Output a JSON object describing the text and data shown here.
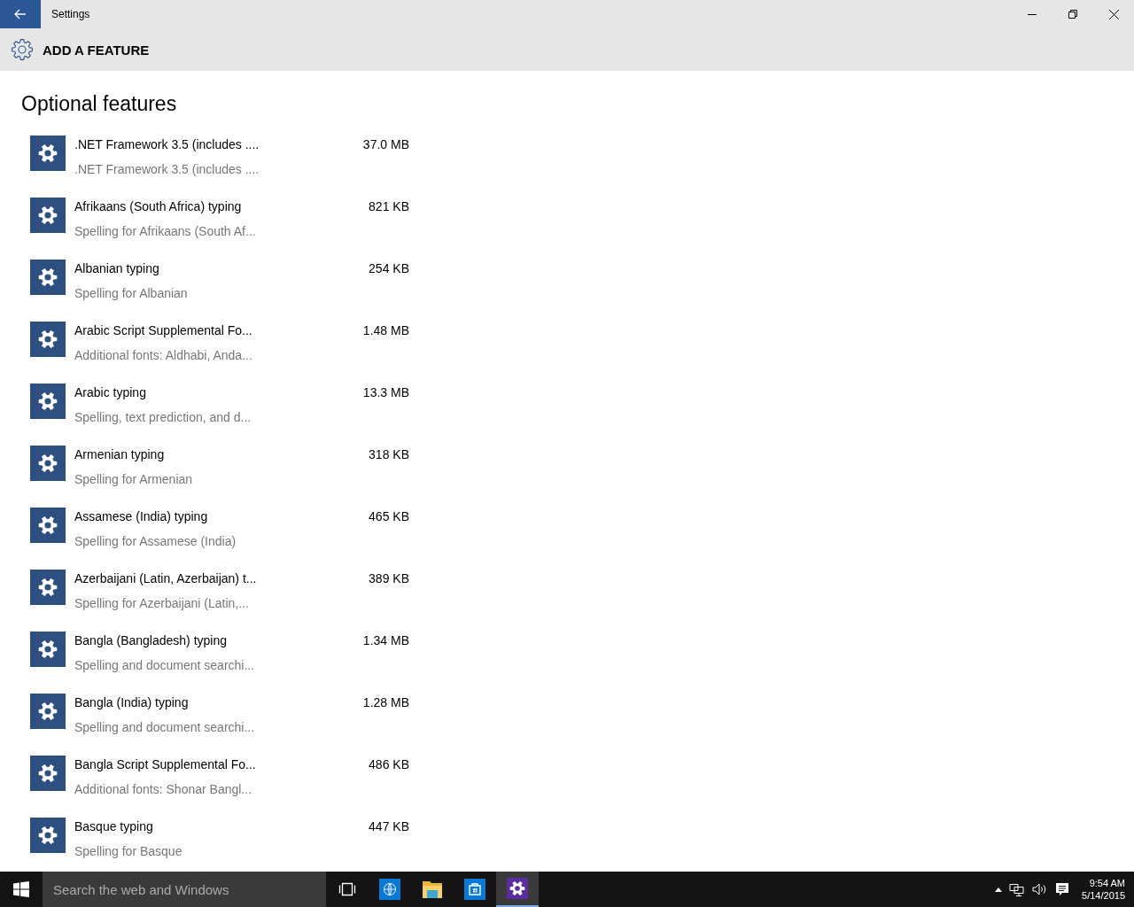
{
  "window": {
    "title": "Settings"
  },
  "header": {
    "title": "ADD A FEATURE"
  },
  "section": {
    "heading": "Optional features"
  },
  "features": [
    {
      "name": ".NET Framework 3.5 (includes ....",
      "size": "37.0 MB",
      "description": ".NET Framework 3.5 (includes ...."
    },
    {
      "name": "Afrikaans (South Africa) typing",
      "size": "821 KB",
      "description": "Spelling for Afrikaans (South Af..."
    },
    {
      "name": "Albanian typing",
      "size": "254 KB",
      "description": "Spelling for Albanian"
    },
    {
      "name": "Arabic Script Supplemental Fo...",
      "size": "1.48 MB",
      "description": "Additional fonts: Aldhabi, Anda..."
    },
    {
      "name": "Arabic typing",
      "size": "13.3 MB",
      "description": "Spelling, text prediction, and d..."
    },
    {
      "name": "Armenian typing",
      "size": "318 KB",
      "description": "Spelling for Armenian"
    },
    {
      "name": "Assamese (India) typing",
      "size": "465 KB",
      "description": "Spelling for Assamese (India)"
    },
    {
      "name": "Azerbaijani (Latin, Azerbaijan) t...",
      "size": "389 KB",
      "description": "Spelling for Azerbaijani (Latin,..."
    },
    {
      "name": "Bangla (Bangladesh) typing",
      "size": "1.34 MB",
      "description": "Spelling and document searchi..."
    },
    {
      "name": "Bangla (India) typing",
      "size": "1.28 MB",
      "description": "Spelling and document searchi..."
    },
    {
      "name": "Bangla Script Supplemental Fo...",
      "size": "486 KB",
      "description": "Additional fonts: Shonar Bangl..."
    },
    {
      "name": "Basque typing",
      "size": "447 KB",
      "description": "Spelling for Basque"
    }
  ],
  "taskbar": {
    "search": {
      "placeholder": "Search the web and Windows"
    },
    "apps": [
      {
        "kind": "taskview",
        "selected": false
      },
      {
        "kind": "browser",
        "selected": false
      },
      {
        "kind": "explorer",
        "selected": false
      },
      {
        "kind": "store",
        "selected": false
      },
      {
        "kind": "settings",
        "selected": true
      }
    ],
    "clock": {
      "time": "9:54 AM",
      "date": "5/14/2015"
    }
  }
}
